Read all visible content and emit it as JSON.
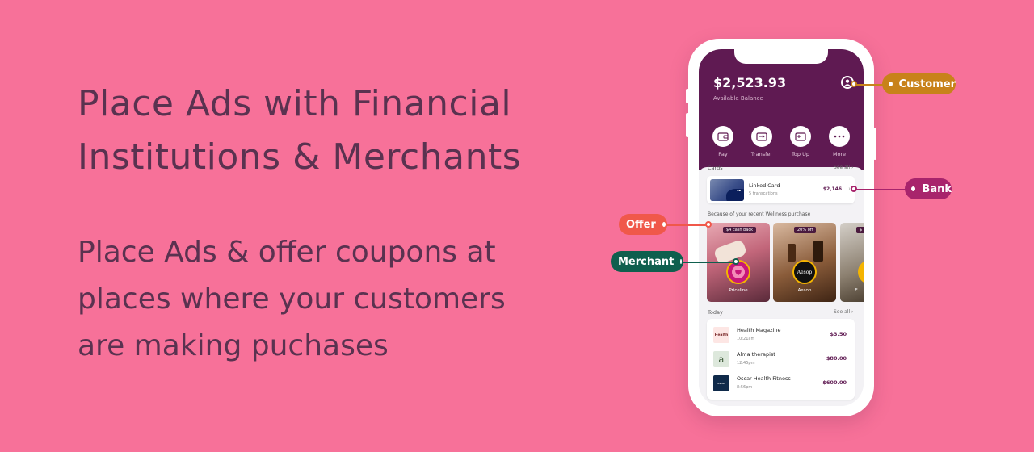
{
  "hero": {
    "headline_line1": "Place Ads with Financial",
    "headline_line2": "Institutions & Merchants",
    "sub_line1": "Place Ads & offer coupons at",
    "sub_line2": "places where your customers",
    "sub_line3": "are making puchases"
  },
  "app": {
    "balance": "$2,523.93",
    "balance_label": "Available Balance",
    "actions": [
      {
        "label": "Pay",
        "icon": "wallet-icon"
      },
      {
        "label": "Transfer",
        "icon": "transfer-icon"
      },
      {
        "label": "Top Up",
        "icon": "topup-icon"
      },
      {
        "label": "More",
        "icon": "more-icon"
      }
    ],
    "cards_section": {
      "title": "Cards",
      "see_all": "See all",
      "card_name": "Linked Card",
      "card_sub": "5 transcations",
      "card_amount": "$2,146"
    },
    "offers_section": {
      "title": "Because of your recent Wellness purchase",
      "offers": [
        {
          "badge": "$4 cash back",
          "merchant": "Priceline"
        },
        {
          "badge": "20% off",
          "merchant": "Aesop"
        },
        {
          "badge": "$",
          "merchant": "E"
        }
      ]
    },
    "today_section": {
      "title": "Today",
      "see_all": "See all",
      "transactions": [
        {
          "logo_text": "Health",
          "name": "Health Magazine",
          "time": "10:21am",
          "amount": "$3.50"
        },
        {
          "logo_text": "a",
          "name": "Alma therapist",
          "time": "12:45pm",
          "amount": "$80.00"
        },
        {
          "logo_text": "oscar",
          "name": "Oscar Health Fitness",
          "time": "8:56pm",
          "amount": "$600.00"
        }
      ]
    }
  },
  "callouts": {
    "customer": {
      "label": "Customer",
      "color": "#c8821a"
    },
    "bank": {
      "label": "Bank",
      "color": "#a8246c"
    },
    "offer": {
      "label": "Offer",
      "color": "#f0584a"
    },
    "merchant": {
      "label": "Merchant",
      "color": "#0f5f4e"
    }
  },
  "colors": {
    "background": "#f77199",
    "text": "#5a3250",
    "app_header": "#5f1a52"
  }
}
